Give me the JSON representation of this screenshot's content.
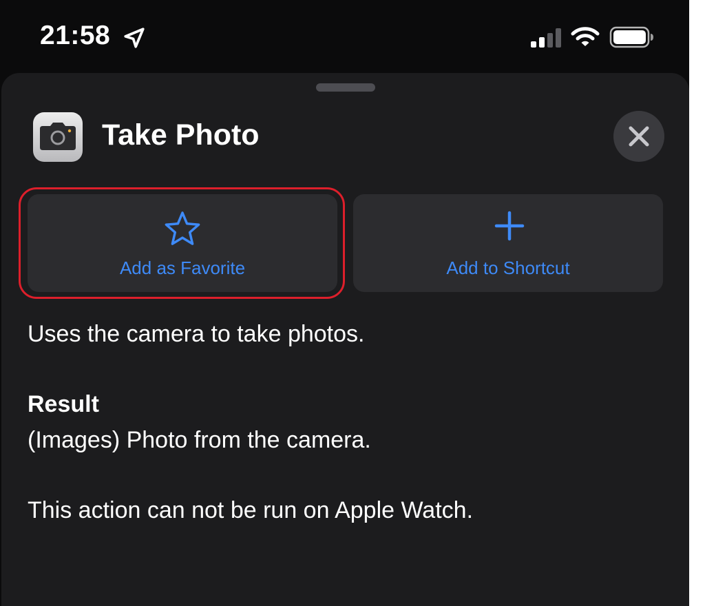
{
  "status_bar": {
    "time": "21:58",
    "icons": [
      "location-arrow-icon",
      "cellular-signal-icon",
      "wifi-icon",
      "battery-icon"
    ]
  },
  "sheet": {
    "title": "Take Photo",
    "app_icon": "camera-icon",
    "close_icon": "close-icon"
  },
  "actions": {
    "favorite": {
      "label": "Add as Favorite",
      "icon": "star-icon"
    },
    "shortcut": {
      "label": "Add to Shortcut",
      "icon": "plus-icon"
    }
  },
  "details": {
    "description": "Uses the camera to take photos.",
    "result_heading": "Result",
    "result_text": "(Images) Photo from the camera.",
    "watch_note": "This action can not be run on Apple Watch."
  },
  "colors": {
    "accent": "#3e8af7",
    "sheet_background": "#1c1c1e",
    "card_background": "#2c2c2f",
    "highlight": "#dd1f2b"
  }
}
